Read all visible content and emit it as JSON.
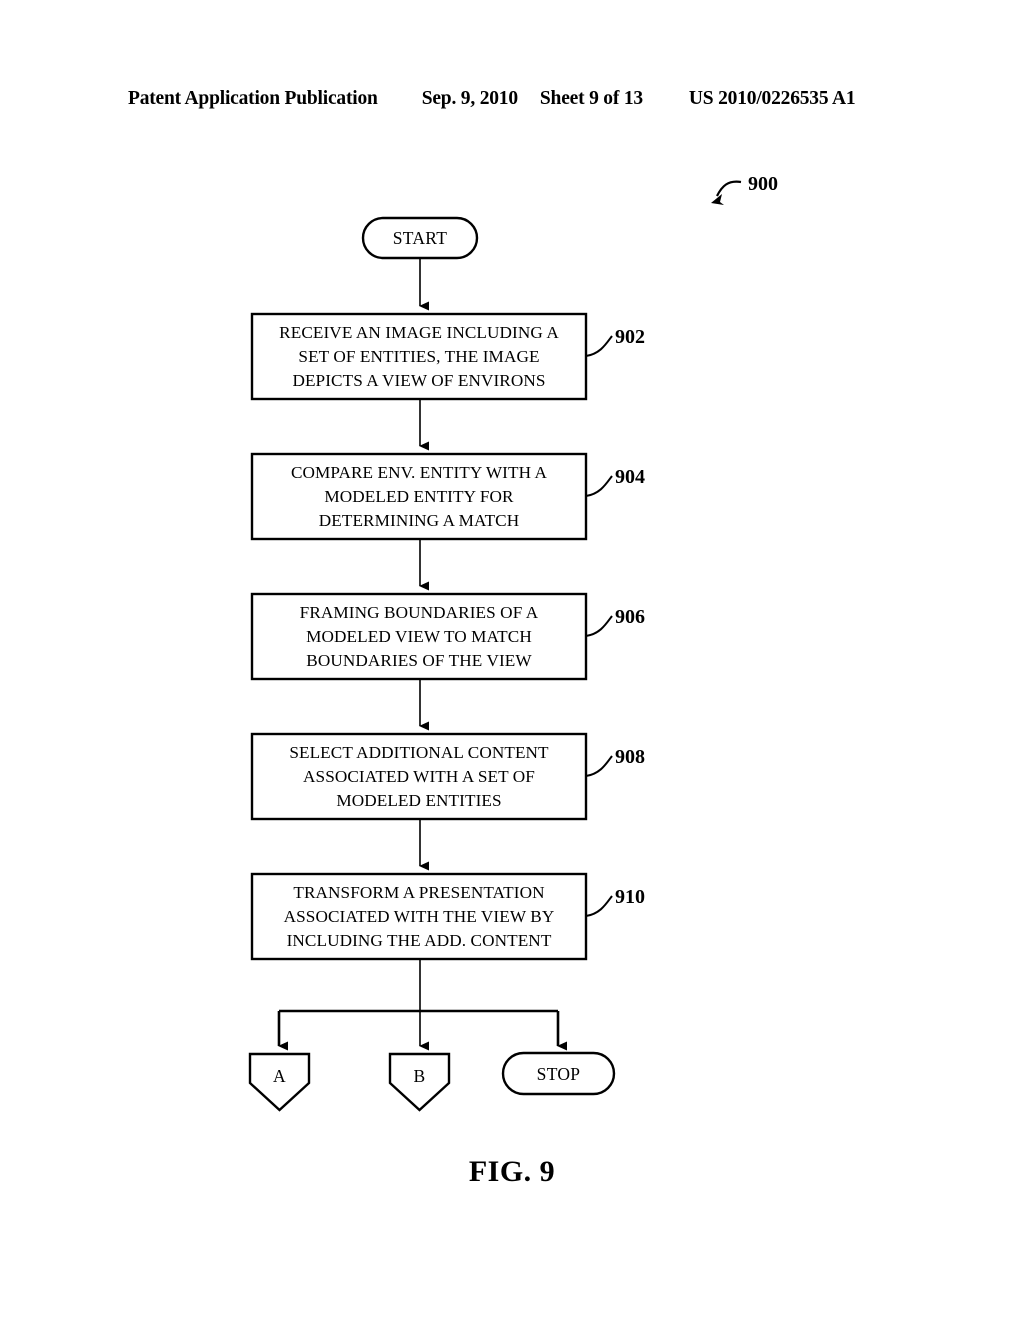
{
  "header": {
    "publication": "Patent Application Publication",
    "date": "Sep. 9, 2010",
    "sheet": "Sheet 9 of 13",
    "patent_number": "US 2010/0226535 A1"
  },
  "figure": {
    "caption": "FIG. 9",
    "reference_number": "900",
    "start_label": "START",
    "stop_label": "STOP",
    "connector_a_label": "A",
    "connector_b_label": "B",
    "steps": [
      {
        "ref": "902",
        "lines": [
          "RECEIVE AN IMAGE INCLUDING A",
          "SET OF ENTITIES, THE IMAGE",
          "DEPICTS A VIEW OF ENVIRONS"
        ]
      },
      {
        "ref": "904",
        "lines": [
          "COMPARE ENV. ENTITY WITH A",
          "MODELED ENTITY FOR",
          "DETERMINING A MATCH"
        ]
      },
      {
        "ref": "906",
        "lines": [
          "FRAMING BOUNDARIES OF A",
          "MODELED VIEW TO MATCH",
          "BOUNDARIES OF THE VIEW"
        ]
      },
      {
        "ref": "908",
        "lines": [
          "SELECT ADDITIONAL CONTENT",
          "ASSOCIATED WITH A SET OF",
          "MODELED ENTITIES"
        ]
      },
      {
        "ref": "910",
        "lines": [
          "TRANSFORM A PRESENTATION",
          "ASSOCIATED WITH THE VIEW BY",
          "INCLUDING THE ADD. CONTENT"
        ]
      }
    ]
  },
  "colors": {
    "ink": "#000000",
    "paper": "#ffffff"
  }
}
